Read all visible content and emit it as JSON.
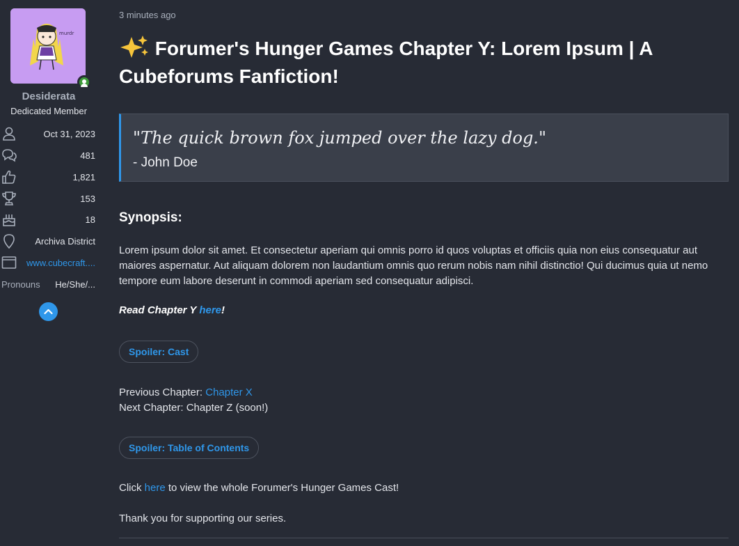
{
  "sidebar": {
    "username": "Desiderata",
    "user_title": "Dedicated Member",
    "avatar_text": "murdr",
    "stats": {
      "joined": {
        "icon": "user-icon",
        "value": "Oct 31, 2023"
      },
      "messages": {
        "icon": "chat-bubbles-icon",
        "value": "481"
      },
      "reactions": {
        "icon": "thumbs-up-icon",
        "value": "1,821"
      },
      "points": {
        "icon": "trophy-icon",
        "value": "153"
      },
      "age": {
        "icon": "birthday-cake-icon",
        "value": "18"
      },
      "location": {
        "icon": "map-pin-icon",
        "value": "Archiva District"
      },
      "website": {
        "icon": "browser-window-icon",
        "value": "www.cubecraft...."
      },
      "pronouns": {
        "label": "Pronouns",
        "value": "He/She/..."
      }
    },
    "collapse_icon": "chevron-up-icon"
  },
  "post": {
    "timestamp": "3 minutes ago",
    "title_emoji": "sparkles-icon",
    "title": "Forumer's Hunger Games Chapter Y: Lorem Ipsum | A Cubeforums Fanfiction!",
    "quote": {
      "text": "\"The quick brown fox jumped over the lazy dog.\"",
      "author": "- John Doe"
    },
    "synopsis_heading": "Synopsis:",
    "synopsis_body": "Lorem ipsum dolor sit amet. Et consectetur aperiam qui omnis porro id quos voluptas et officiis quia non eius consequatur aut maiores aspernatur. Aut aliquam dolorem non laudantium omnis quo rerum nobis nam nihil distinctio! Qui ducimus quia ut nemo tempore eum labore deserunt in commodi aperiam sed consequatur adipisci.",
    "read_prefix": "Read Chapter Y ",
    "read_link": "here",
    "read_suffix": "!",
    "spoiler_cast": "Spoiler: Cast",
    "previous_label": "Previous Chapter: ",
    "previous_link": "Chapter X",
    "next_text": "Next Chapter: Chapter Z (soon!)",
    "spoiler_toc": "Spoiler: Table of Contents",
    "click_prefix": "Click ",
    "click_link": "here",
    "click_suffix": " to view the whole Forumer's Hunger Games Cast!",
    "thanks": "Thank you for supporting our series."
  },
  "colors": {
    "background": "#272b35",
    "accent": "#2f97ea",
    "quote_bg": "#3a3f4a",
    "online": "#3e9b3a",
    "avatar_bg": "#c79cf2"
  }
}
